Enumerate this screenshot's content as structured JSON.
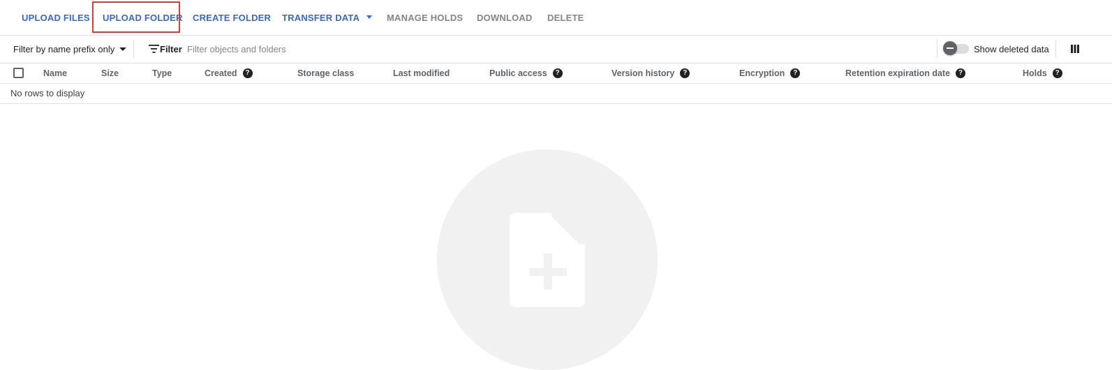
{
  "toolbar": {
    "upload_files": "UPLOAD FILES",
    "upload_folder": "UPLOAD FOLDER",
    "create_folder": "CREATE FOLDER",
    "transfer_data": "TRANSFER DATA",
    "manage_holds": "MANAGE HOLDS",
    "download": "DOWNLOAD",
    "delete": "DELETE",
    "primary_color": "#3367d6",
    "disabled_color": "#80868b",
    "highlight_color": "#e53935"
  },
  "filter_bar": {
    "prefix_select": "Filter by name prefix only",
    "filter_label": "Filter",
    "filter_placeholder": "Filter objects and folders",
    "show_deleted_label": "Show deleted data",
    "show_deleted_on": false,
    "filter_icon": "filter-list-icon",
    "columns_icon": "column-display-icon"
  },
  "table": {
    "columns": [
      {
        "label": "Name",
        "help": false
      },
      {
        "label": "Size",
        "help": false
      },
      {
        "label": "Type",
        "help": false
      },
      {
        "label": "Created",
        "help": true
      },
      {
        "label": "Storage class",
        "help": false
      },
      {
        "label": "Last modified",
        "help": false
      },
      {
        "label": "Public access",
        "help": true
      },
      {
        "label": "Version history",
        "help": true
      },
      {
        "label": "Encryption",
        "help": true
      },
      {
        "label": "Retention expiration date",
        "help": true
      },
      {
        "label": "Holds",
        "help": true
      }
    ],
    "help_glyph": "?",
    "empty_message": "No rows to display"
  },
  "empty_state": {
    "icon": "file-add-icon"
  }
}
